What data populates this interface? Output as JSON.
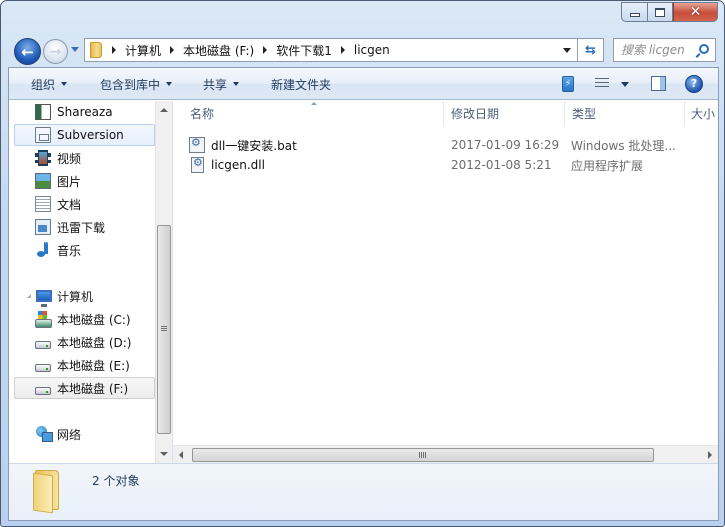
{
  "window": {
    "caption_buttons": {
      "minimize": "minimize",
      "maximize": "maximize",
      "close": "close"
    }
  },
  "navigation": {
    "back_icon": "back-arrow-icon",
    "forward_icon": "forward-arrow-icon",
    "breadcrumb": [
      "计算机",
      "本地磁盘 (F:)",
      "软件下载1",
      "licgen"
    ],
    "search_placeholder": "搜索 licgen"
  },
  "toolbar": {
    "organize": "组织",
    "include_in_library": "包含到库中",
    "share": "共享",
    "new_folder": "新建文件夹"
  },
  "sidebar": {
    "libraries": [
      {
        "label": "Shareaza",
        "icon": "app-icon"
      },
      {
        "label": "Subversion",
        "icon": "document-icon",
        "selected": true
      },
      {
        "label": "视频",
        "icon": "video-icon"
      },
      {
        "label": "图片",
        "icon": "picture-icon"
      },
      {
        "label": "文档",
        "icon": "text-document-icon"
      },
      {
        "label": "迅雷下载",
        "icon": "download-icon"
      },
      {
        "label": "音乐",
        "icon": "music-icon"
      }
    ],
    "computer": {
      "label": "计算机",
      "drives": [
        {
          "label": "本地磁盘 (C:)",
          "icon": "system-drive-icon"
        },
        {
          "label": "本地磁盘 (D:)",
          "icon": "drive-icon"
        },
        {
          "label": "本地磁盘 (E:)",
          "icon": "drive-icon"
        },
        {
          "label": "本地磁盘 (F:)",
          "icon": "drive-icon",
          "active": true
        }
      ]
    },
    "network": {
      "label": "网络"
    }
  },
  "file_list": {
    "columns": [
      "名称",
      "修改日期",
      "类型",
      "大小"
    ],
    "files": [
      {
        "name": "dll一键安装.bat",
        "modified": "2017-01-09 16:29",
        "type": "Windows 批处理...",
        "icon": "batch-file-icon"
      },
      {
        "name": "licgen.dll",
        "modified": "2012-01-08 5:21",
        "type": "应用程序扩展",
        "icon": "dll-file-icon"
      }
    ]
  },
  "details_pane": {
    "item_count": "2 个对象"
  }
}
